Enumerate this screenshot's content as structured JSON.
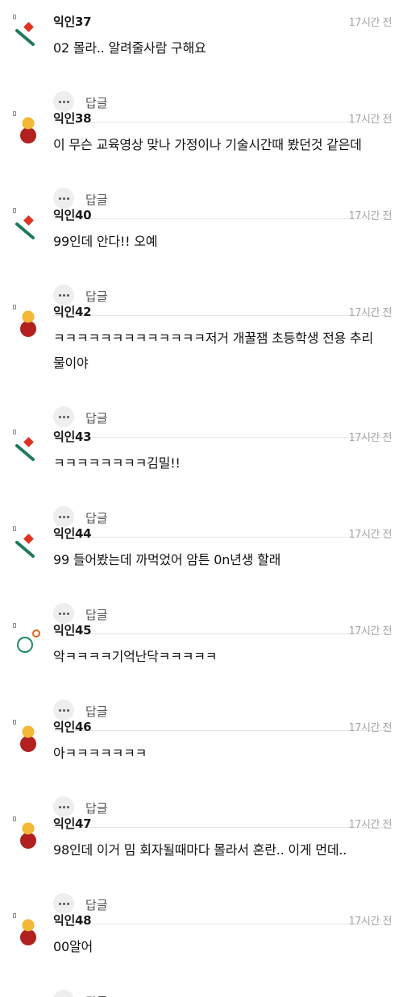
{
  "reply_label": "답글",
  "comments": [
    {
      "author": "익인37",
      "time": "17시간 전",
      "text": "02 몰라.. 알려줄사람 구해요",
      "avatar": "green-red-pennant-icon"
    },
    {
      "author": "익인38",
      "time": "17시간 전",
      "text": "이 무슨 교육영상 맞나 가정이나 기술시간때 봤던것 같은데",
      "avatar": "yellow-red-figure-icon"
    },
    {
      "author": "익인40",
      "time": "17시간 전",
      "text": "99인데 안다!! 오예",
      "avatar": "green-red-pennant-icon"
    },
    {
      "author": "익인42",
      "time": "17시간 전",
      "text": "ㅋㅋㅋㅋㅋㅋㅋㅋㅋㅋㅋㅋㅋ저거 개꿀잼 초등학생 전용 추리 물이야",
      "avatar": "yellow-red-figure-icon"
    },
    {
      "author": "익인43",
      "time": "17시간 전",
      "text": "ㅋㅋㅋㅋㅋㅋㅋㅋ김밀!!",
      "avatar": "green-red-pennant-icon"
    },
    {
      "author": "익인44",
      "time": "17시간 전",
      "text": "99 들어봤는데 까먹었어 암튼 0n년생 할래",
      "avatar": "green-red-pennant-icon"
    },
    {
      "author": "익인45",
      "time": "17시간 전",
      "text": "악ㅋㅋㅋㅋ기억난닥ㅋㅋㅋㅋㅋ",
      "avatar": "green-orange-rings-icon"
    },
    {
      "author": "익인46",
      "time": "17시간 전",
      "text": "아ㅋㅋㅋㅋㅋㅋㅋ",
      "avatar": "yellow-red-figure-icon"
    },
    {
      "author": "익인47",
      "time": "17시간 전",
      "text": "98인데 이거 밈 회자될때마다 몰라서 혼란.. 이게 먼데..",
      "avatar": "yellow-red-figure-icon"
    },
    {
      "author": "익인48",
      "time": "17시간 전",
      "text": "00알어",
      "avatar": "yellow-red-figure-icon"
    }
  ]
}
